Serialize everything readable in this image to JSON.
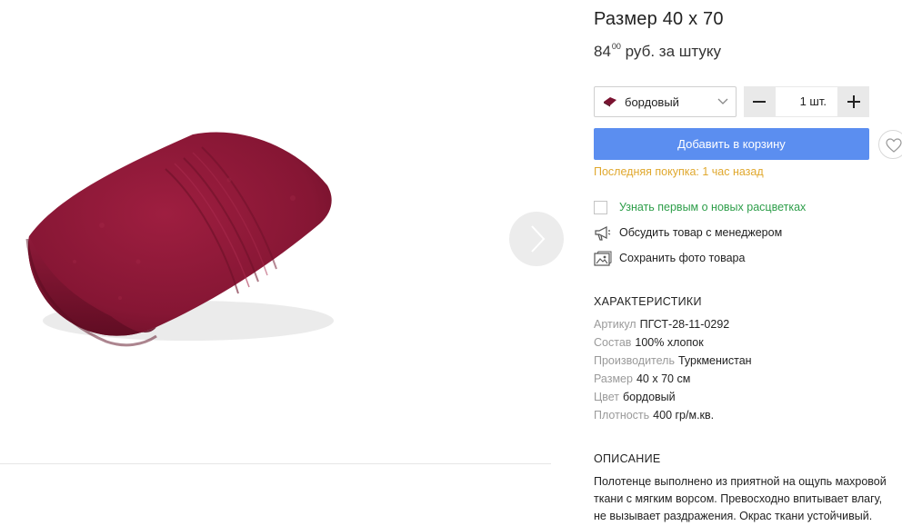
{
  "product": {
    "title": "Размер 40 х 70",
    "price_main": "84",
    "price_cents": "00",
    "price_unit": "руб. за штуку",
    "image_alt": "",
    "towel_color": "#8a1633"
  },
  "selector": {
    "color_label": "бордовый",
    "swatch_color": "#7a1230",
    "quantity": "1 шт."
  },
  "actions": {
    "add_to_cart": "Добавить в корзину",
    "last_purchase": "Последняя покупка: 1 час назад",
    "notify_new_colors": "Узнать первым о новых расцветках",
    "discuss_with_manager": "Обсудить товар с менеджером",
    "save_photo": "Сохранить фото товара"
  },
  "characteristics": {
    "heading": "ХАРАКТЕРИСТИКИ",
    "rows": [
      {
        "key": "Артикул",
        "value": "ПГСТ-28-11-0292"
      },
      {
        "key": "Состав",
        "value": "100% хлопок"
      },
      {
        "key": "Производитель",
        "value": "Туркменистан"
      },
      {
        "key": "Размер",
        "value": "40 х 70 см"
      },
      {
        "key": "Цвет",
        "value": "бордовый"
      },
      {
        "key": "Плотность",
        "value": "400 гр/м.кв."
      }
    ]
  },
  "description": {
    "heading": "ОПИСАНИЕ",
    "lines": [
      "Полотенце выполнено из приятной на ощупь махровой",
      "ткани с мягким ворсом. Превосходно впитывает влагу,",
      "не вызывает раздражения. Окрас ткани устойчивый."
    ]
  },
  "colors": {
    "accent_button": "#5b8ef0",
    "last_purchase_text": "#e0a82e",
    "link_green": "#2e9e4a",
    "label_grey": "#9a9a9a"
  },
  "icons": {
    "next": "chevron-right-icon",
    "select": "chevron-down-icon",
    "minus": "minus-icon",
    "plus": "plus-icon",
    "wishlist": "heart-icon",
    "manager": "megaphone-icon",
    "photo": "image-icon"
  }
}
